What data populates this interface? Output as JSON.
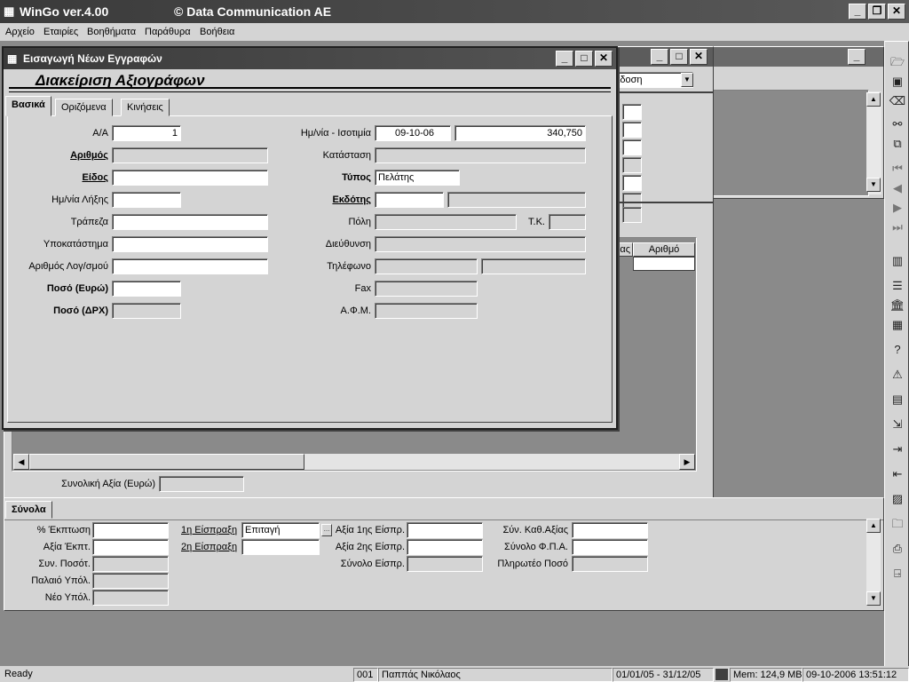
{
  "app": {
    "title": "WinGo ver.4.00",
    "company": "© Data Communication AE"
  },
  "menu": [
    "Αρχείο",
    "Εταιρίες",
    "Βοηθήματα",
    "Παράθυρα",
    "Βοήθεια"
  ],
  "bg_window": {
    "combo_value": "κδοση",
    "grid_header": [
      "ας",
      "Αριθμό"
    ]
  },
  "mid_window": {
    "total_label": "Συνολική Αξία (Ευρώ)",
    "total_value": ""
  },
  "bottom": {
    "tab": "Σύνολα",
    "col1": [
      {
        "label": "% Έκπτωση",
        "value": ""
      },
      {
        "label": "Αξία Έκπτ.",
        "value": ""
      },
      {
        "label": "Συν. Ποσότ.",
        "value": ""
      },
      {
        "label": "Παλαιό Υπόλ.",
        "value": ""
      },
      {
        "label": "Νέο Υπόλ.",
        "value": ""
      }
    ],
    "col2": [
      {
        "label": "1η Είσπραξη",
        "value": "Επιταγή"
      },
      {
        "label": "2η Είσπραξη",
        "value": ""
      }
    ],
    "col3": [
      {
        "label": "Αξία 1ης Είσπρ.",
        "value": ""
      },
      {
        "label": "Αξία 2ης Είσπρ.",
        "value": ""
      },
      {
        "label": "Σύνολο Είσπρ.",
        "value": ""
      }
    ],
    "col4": [
      {
        "label": "Σύν. Καθ.Αξίας",
        "value": ""
      },
      {
        "label": "Σύνολο Φ.Π.Α.",
        "value": ""
      },
      {
        "label": "Πληρωτέο Ποσό",
        "value": ""
      }
    ]
  },
  "dialog": {
    "title": "Εισαγωγή Νέων Εγγραφών",
    "heading": "Διακείριση Αξιογράφων",
    "tabs": [
      "Βασικά",
      "Οριζόμενα",
      "Κινήσεις"
    ],
    "left": [
      {
        "label": "Α/Α",
        "value": "1"
      },
      {
        "label": "Αριθμός",
        "value": ""
      },
      {
        "label": "Είδος",
        "value": ""
      },
      {
        "label": "Ημ/νία Λήξης",
        "value": ""
      },
      {
        "label": "Τράπεζα",
        "value": ""
      },
      {
        "label": "Υποκατάστημα",
        "value": ""
      },
      {
        "label": "Αριθμός Λογ/σμού",
        "value": ""
      },
      {
        "label": "Ποσό (Ευρώ)",
        "value": ""
      },
      {
        "label": "Ποσό (ΔΡΧ)",
        "value": ""
      }
    ],
    "right": {
      "date_label": "Ημ/νία - Ισοτιμία",
      "date_value": "09-10-06",
      "rate_value": "340,750",
      "status_label": "Κατάσταση",
      "status_value": "",
      "type_label": "Τύπος",
      "type_value": "Πελάτης",
      "issuer_label": "Εκδότης",
      "issuer_code": "",
      "issuer_name": "",
      "city_label": "Πόλη",
      "city_value": "",
      "zip_label": "Τ.Κ.",
      "zip_value": "",
      "address_label": "Διεύθυνση",
      "address_value": "",
      "phone_label": "Τηλέφωνο",
      "phone1": "",
      "phone2": "",
      "fax_label": "Fax",
      "fax_value": "",
      "afm_label": "Α.Φ.Μ.",
      "afm_value": ""
    }
  },
  "status": {
    "ready": "Ready",
    "code": "001",
    "user": "Παππάς Νικόλαος",
    "period": "01/01/05 - 31/12/05",
    "mem": "Mem: 124,9 MB",
    "datetime": "09-10-2006 13:51:12"
  }
}
